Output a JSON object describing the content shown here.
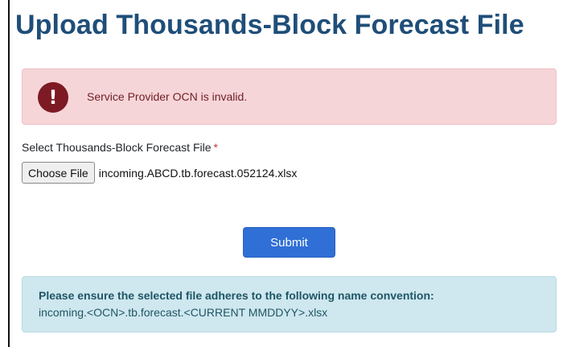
{
  "page": {
    "title": "Upload Thousands-Block Forecast File"
  },
  "error_alert": {
    "icon": "exclamation-circle-icon",
    "icon_glyph": "!",
    "message": "Service Provider OCN is invalid."
  },
  "form": {
    "file_label": "Select Thousands-Block Forecast File",
    "required_marker": "*",
    "choose_file_label": "Choose File",
    "selected_file_name": "incoming.ABCD.tb.forecast.052124.xlsx",
    "submit_label": "Submit"
  },
  "info_alert": {
    "heading": "Please ensure the selected file adheres to the following name convention:",
    "convention": "incoming.<OCN>.tb.forecast.<CURRENT MMDDYY>.xlsx"
  },
  "colors": {
    "title": "#1f4e79",
    "error_background": "#f6d5d8",
    "error_icon": "#7d1a24",
    "error_text": "#6e1f27",
    "primary_button": "#2f6fd6",
    "info_background": "#cfe7ee",
    "info_text": "#1e5666",
    "required_marker": "#c0392b"
  }
}
